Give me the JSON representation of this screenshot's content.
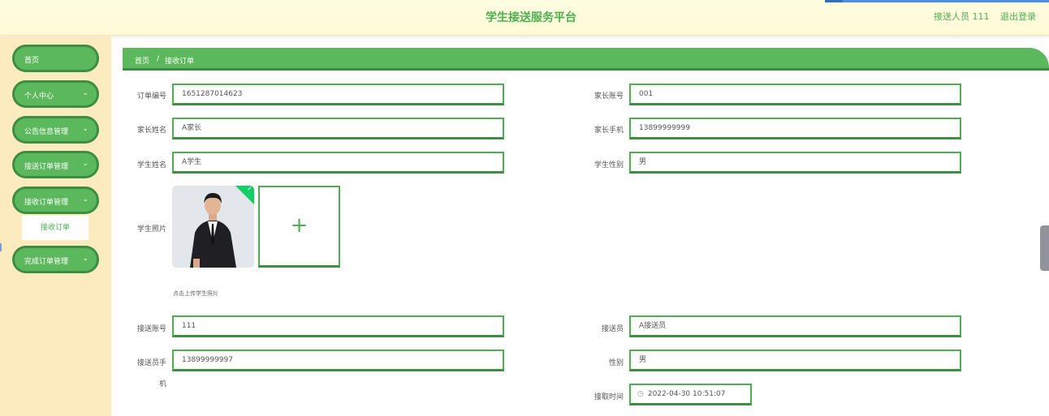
{
  "header": {
    "title": "学生接送服务平台",
    "user": "接送人员 111",
    "logout": "退出登录"
  },
  "sidebar": {
    "items": [
      {
        "label": "首页"
      },
      {
        "label": "个人中心",
        "icon": "chevron-down-icon"
      },
      {
        "label": "公告信息管理",
        "icon": "chevron-down-icon"
      },
      {
        "label": "接送订单管理",
        "icon": "chevron-down-icon"
      },
      {
        "label": "接收订单管理",
        "icon": "chevron-down-icon"
      },
      {
        "label": "完成订单管理",
        "icon": "chevron-down-icon"
      }
    ],
    "subitem": "接收订单"
  },
  "breadcrumb": {
    "home": "首页",
    "separator": "/",
    "current": "接收订单"
  },
  "form": {
    "order_no": {
      "label": "订单编号",
      "value": "1651287014623"
    },
    "parent_account": {
      "label": "家长账号",
      "value": "001"
    },
    "parent_name": {
      "label": "家长姓名",
      "value": "A家长"
    },
    "parent_phone": {
      "label": "家长手机",
      "value": "13899999999"
    },
    "student_name": {
      "label": "学生姓名",
      "value": "A学生"
    },
    "student_gender": {
      "label": "学生性别",
      "value": "男"
    },
    "student_photo": {
      "label": "学生照片",
      "hint": "点击上传学生照片"
    },
    "driver_account": {
      "label": "接送账号",
      "value": "111"
    },
    "driver_name": {
      "label": "接送员",
      "value": "A接送员"
    },
    "driver_phone": {
      "label": "接送员手",
      "label2": "机",
      "value": "13899999997"
    },
    "driver_gender": {
      "label": "性别",
      "value": "男"
    },
    "receive_time": {
      "label": "接取时间",
      "value": "2022-04-30 10:51:07"
    }
  },
  "colors": {
    "accent": "#5cb85c",
    "accent_dark": "#3e8e41",
    "sidebar_bg": "#fdebc0",
    "header_bg": "#fffde0"
  }
}
